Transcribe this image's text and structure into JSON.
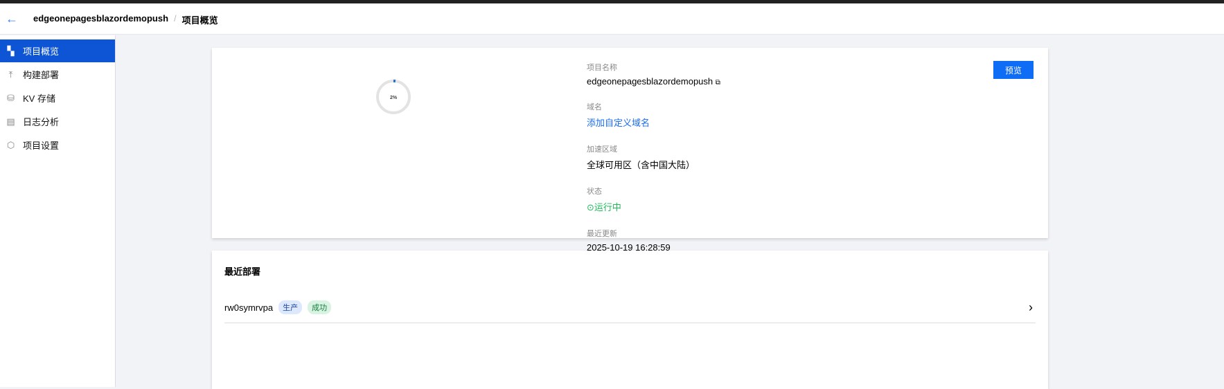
{
  "header": {
    "project": "edgeonepagesblazordemopush",
    "page": "项目概览",
    "separator": "/"
  },
  "sidebar": {
    "items": [
      {
        "label": "项目概览",
        "icon": "dashboard-icon"
      },
      {
        "label": "构建部署",
        "icon": "upload-icon"
      },
      {
        "label": "KV 存储",
        "icon": "database-icon"
      },
      {
        "label": "日志分析",
        "icon": "document-icon"
      },
      {
        "label": "项目设置",
        "icon": "settings-icon"
      }
    ]
  },
  "overview": {
    "progress_text": "2%",
    "progress": 2,
    "preview_label": "预览",
    "fields": {
      "name_label": "项目名称",
      "name": "edgeonepagesblazordemopush",
      "domain_label": "域名",
      "domain_link": "添加自定义域名",
      "region_label": "加速区域",
      "region": "全球可用区（含中国大陆）",
      "status_label": "状态",
      "status": "运行中",
      "updated_label": "最近更新",
      "updated": "2025-10-19 16:28:59"
    }
  },
  "deployments": {
    "title": "最近部署",
    "items": [
      {
        "id": "rw0symrvpa",
        "env": "生产",
        "result": "成功"
      }
    ]
  },
  "colors": {
    "accent": "#0d55d4",
    "success": "#1db95a"
  }
}
